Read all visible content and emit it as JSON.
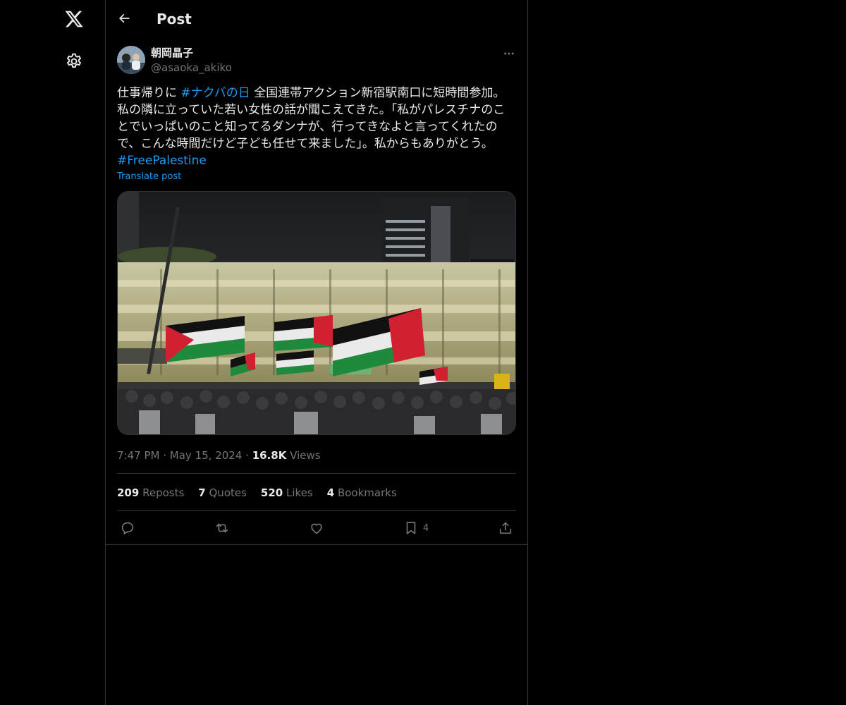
{
  "nav": {
    "logo_icon": "x-logo-icon",
    "settings_icon": "gear-icon"
  },
  "header": {
    "back_icon": "arrow-left-icon",
    "title": "Post"
  },
  "author": {
    "display_name": "朝岡晶子",
    "handle": "@asaoka_akiko"
  },
  "post": {
    "text_part1": "仕事帰りに ",
    "hashtag1": "#ナクバの日",
    "text_part2": " 全国連帯アクション新宿駅南口に短時間参加。私の隣に立っていた若い女性の話が聞こえてきた。「私がパレスチナのことでいっぱいのこと知ってるダンナが、行ってきなよと言ってくれたので、こんな時間だけど子ども任せて来ました」。私からもありがとう。\n",
    "hashtag2": "#FreePalestine",
    "translate_label": "Translate post"
  },
  "meta": {
    "time": "7:47 PM",
    "separator": "·",
    "date": "May 15, 2024",
    "views_count": "16.8K",
    "views_label": "Views"
  },
  "stats": {
    "reposts_count": "209",
    "reposts_label": "Reposts",
    "quotes_count": "7",
    "quotes_label": "Quotes",
    "likes_count": "520",
    "likes_label": "Likes",
    "bookmarks_count": "4",
    "bookmarks_label": "Bookmarks"
  },
  "actions": {
    "bookmark_count": "4"
  },
  "colors": {
    "background": "#000000",
    "accent": "#1d9bf0",
    "text": "#e7e9ea",
    "muted": "#71767b",
    "border": "#2f3336"
  }
}
